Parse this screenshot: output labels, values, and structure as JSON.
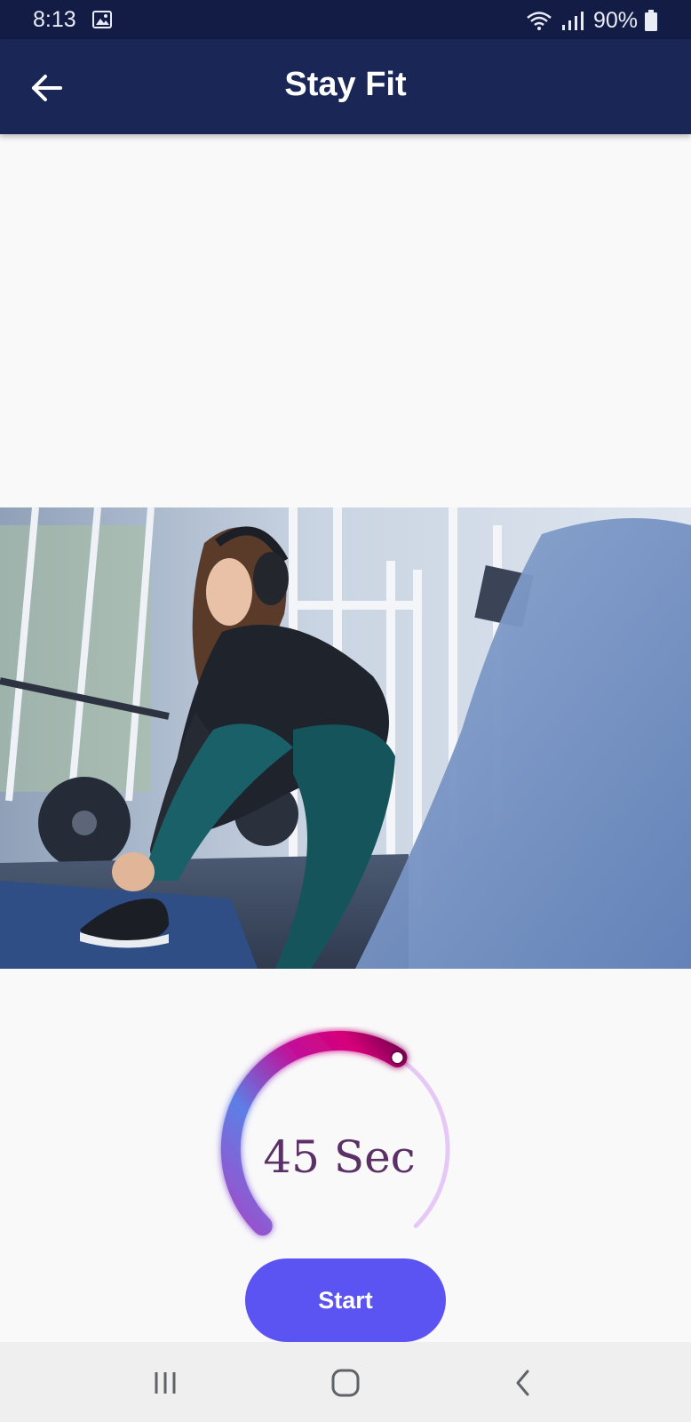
{
  "status_bar": {
    "time": "8:13",
    "battery_text": "90%",
    "icons": [
      "image-notification-icon",
      "wifi-icon",
      "signal-icon",
      "battery-icon"
    ]
  },
  "app_bar": {
    "title": "Stay Fit",
    "back_icon": "arrow-left-icon"
  },
  "hero_image": {
    "description_icon": "gym-photo"
  },
  "timer": {
    "label": "45 Sec",
    "progress_fraction": 0.62,
    "colors": {
      "gradient_start": "#a24bc9",
      "gradient_mid": "#5d7fe6",
      "gradient_end": "#d6007a",
      "track": "#e6c8f6",
      "text": "#5a3067"
    }
  },
  "start_button": {
    "label": "Start",
    "color": "#5b53f2"
  },
  "nav_bar": {
    "icons": [
      "recent-apps-icon",
      "home-icon",
      "back-icon"
    ]
  },
  "colors": {
    "status_bar_bg": "#121c45",
    "app_bar_bg": "#192656",
    "page_bg": "#f9f9fa"
  }
}
